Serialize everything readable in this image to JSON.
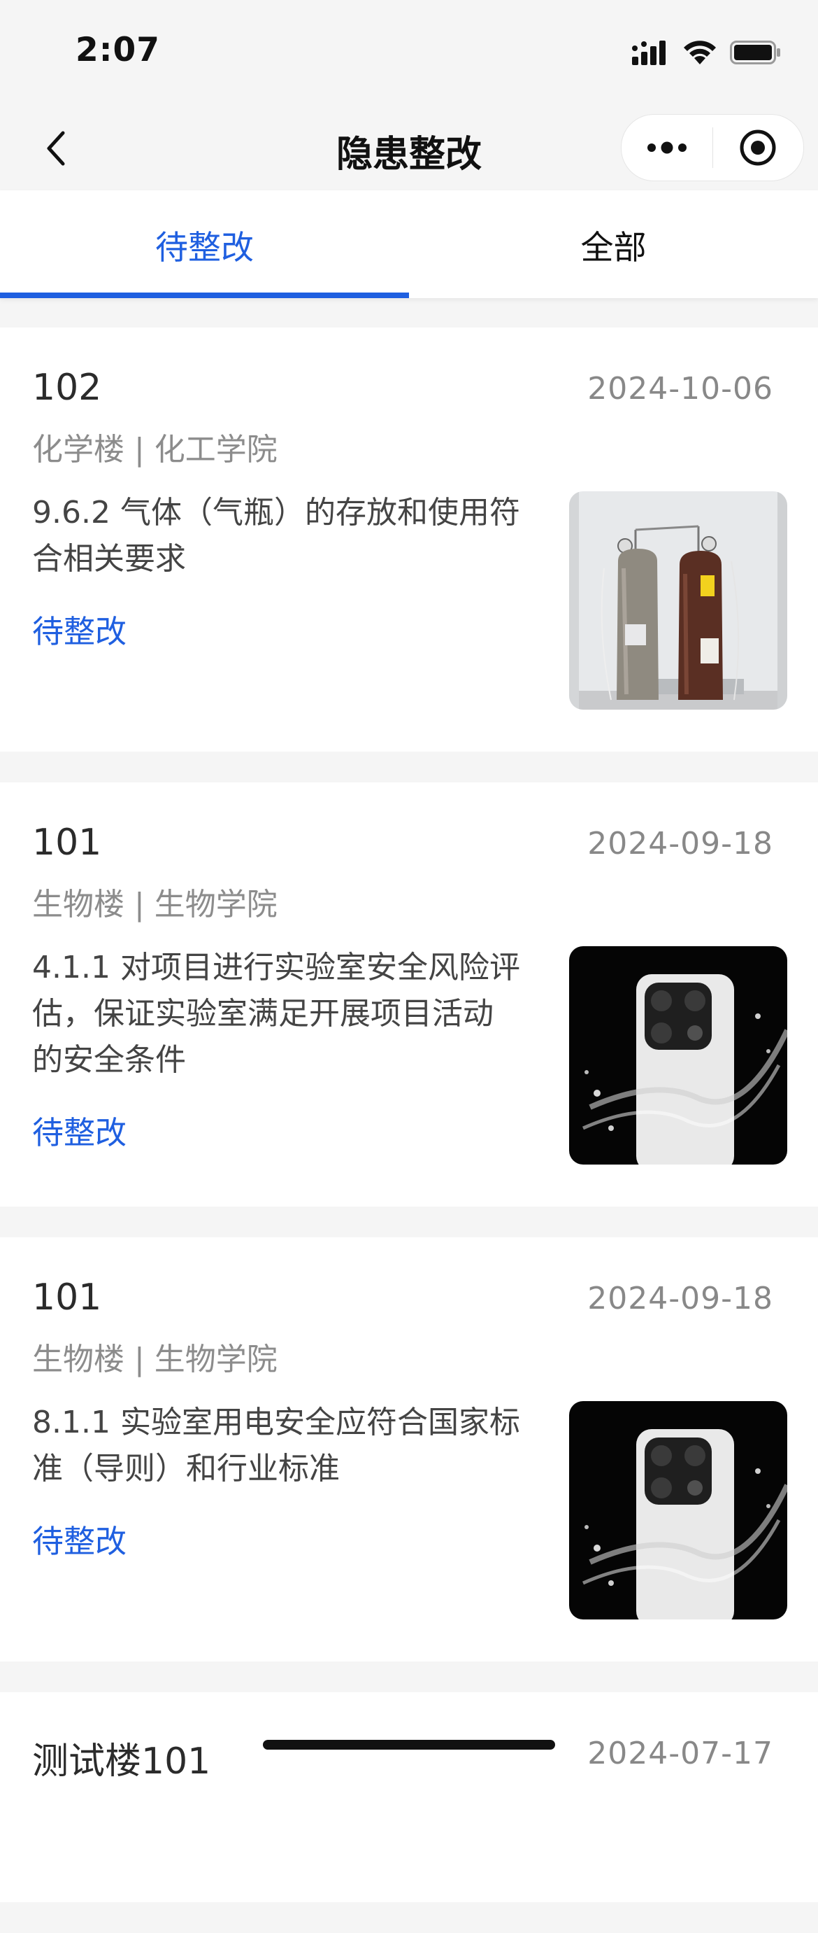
{
  "status_bar": {
    "time": "2:07"
  },
  "nav": {
    "title": "隐患整改"
  },
  "tabs": [
    {
      "label": "待整改",
      "active": true
    },
    {
      "label": "全部",
      "active": false
    }
  ],
  "items": [
    {
      "room": "102",
      "date": "2024-10-06",
      "location": "化学楼 | 化工学院",
      "description": "9.6.2 气体（气瓶）的存放和使用符合相关要求",
      "status": "待整改",
      "image": "gas-cylinders-photo"
    },
    {
      "room": "101",
      "date": "2024-09-18",
      "location": "生物楼 | 生物学院",
      "description": "4.1.1 对项目进行实验室安全风险评估，保证实验室满足开展项目活动的安全条件",
      "status": "待整改",
      "image": "phone-splash-photo"
    },
    {
      "room": "101",
      "date": "2024-09-18",
      "location": "生物楼 | 生物学院",
      "description": "8.1.1 实验室用电安全应符合国家标准（导则）和行业标准",
      "status": "待整改",
      "image": "phone-splash-photo"
    },
    {
      "room": "测试楼101",
      "date": "2024-07-17"
    }
  ],
  "colors": {
    "accent": "#1f5fe0",
    "background": "#f5f5f5"
  }
}
